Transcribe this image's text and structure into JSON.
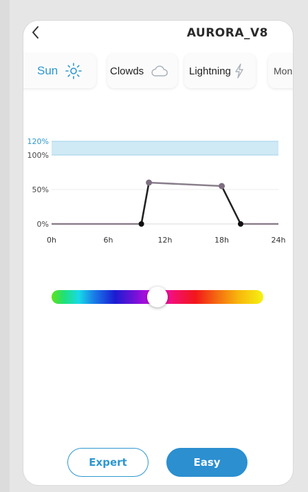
{
  "header": {
    "title": "AURORA_V8",
    "back_icon": "chevron-left-icon"
  },
  "tabs": [
    {
      "label": "Sun",
      "icon": "sun-icon",
      "active": true
    },
    {
      "label": "Clowds",
      "icon": "cloud-icon",
      "active": false
    },
    {
      "label": "Lightning",
      "icon": "lightning-icon",
      "active": false
    },
    {
      "label": "Mon",
      "icon": "",
      "active": false
    }
  ],
  "colors": {
    "accent": "#2d97cf",
    "curve": "#8a7f8c",
    "point_peak": "#7d6e80",
    "point_base": "#111111",
    "over_band": "#cfe9f5"
  },
  "chart_data": {
    "type": "line",
    "x": [
      0,
      9.5,
      10.3,
      18.0,
      20.0,
      24
    ],
    "y": [
      0,
      0,
      60,
      55,
      0,
      0
    ],
    "markers": [
      {
        "x": 9.5,
        "y": 0
      },
      {
        "x": 10.3,
        "y": 60
      },
      {
        "x": 18.0,
        "y": 55
      },
      {
        "x": 20.0,
        "y": 0
      }
    ],
    "xticks": [
      "0h",
      "6h",
      "12h",
      "18h",
      "24h"
    ],
    "yticks": [
      "0%",
      "50%",
      "100%",
      "120%"
    ],
    "xlim": [
      0,
      24
    ],
    "ylim": [
      0,
      120
    ],
    "shaded_band": [
      100,
      120
    ]
  },
  "color_slider": {
    "value": 0.5
  },
  "buttons": {
    "expert": "Expert",
    "easy": "Easy"
  }
}
